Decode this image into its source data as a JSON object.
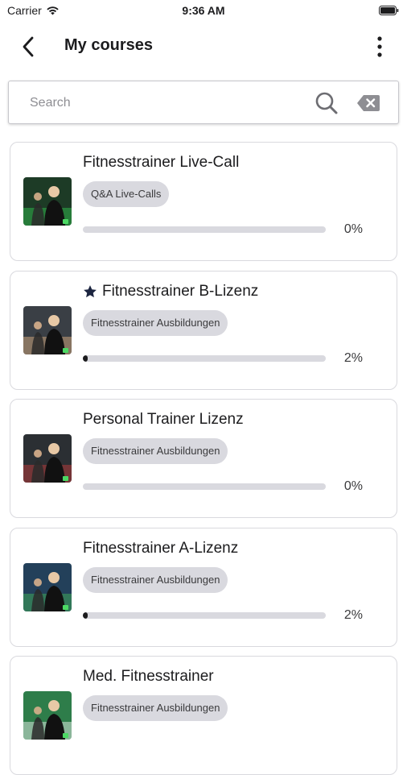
{
  "status_bar": {
    "carrier": "Carrier",
    "time": "9:36 AM"
  },
  "header": {
    "title": "My courses"
  },
  "search": {
    "placeholder": "Search",
    "value": ""
  },
  "courses": [
    {
      "title": "Fitnesstrainer Live-Call",
      "starred": false,
      "category": "Q&A Live-Calls",
      "progress": 0,
      "progress_label": "0%",
      "thumb_colors": [
        "#1d3b26",
        "#2fb34a"
      ]
    },
    {
      "title": "Fitnesstrainer B-Lizenz",
      "starred": true,
      "category": "Fitnesstrainer Ausbildungen",
      "progress": 0.02,
      "progress_label": "2%",
      "thumb_colors": [
        "#3a3f45",
        "#c9a27a"
      ]
    },
    {
      "title": "Personal Trainer Lizenz",
      "starred": false,
      "category": "Fitnesstrainer Ausbildungen",
      "progress": 0,
      "progress_label": "0%",
      "thumb_colors": [
        "#2b2f33",
        "#b23a3a"
      ]
    },
    {
      "title": "Fitnesstrainer A-Lizenz",
      "starred": false,
      "category": "Fitnesstrainer Ausbildungen",
      "progress": 0.02,
      "progress_label": "2%",
      "thumb_colors": [
        "#23405a",
        "#3fa55a"
      ]
    },
    {
      "title": "Med. Fitnesstrainer",
      "starred": false,
      "category": "Fitnesstrainer Ausbildungen",
      "progress": null,
      "progress_label": "",
      "thumb_colors": [
        "#2e7d4a",
        "#d9e6dd"
      ]
    }
  ],
  "colors": {
    "star": "#1c2540",
    "progress_fill": "#1c1c1e",
    "progress_track": "#d9d9df",
    "chip_bg": "#d9d9df"
  },
  "icons": {
    "back": "chevron-left-icon",
    "more": "more-vertical-icon",
    "search": "search-icon",
    "clear": "backspace-clear-icon",
    "star": "star-icon",
    "wifi": "wifi-icon",
    "battery": "battery-icon"
  }
}
